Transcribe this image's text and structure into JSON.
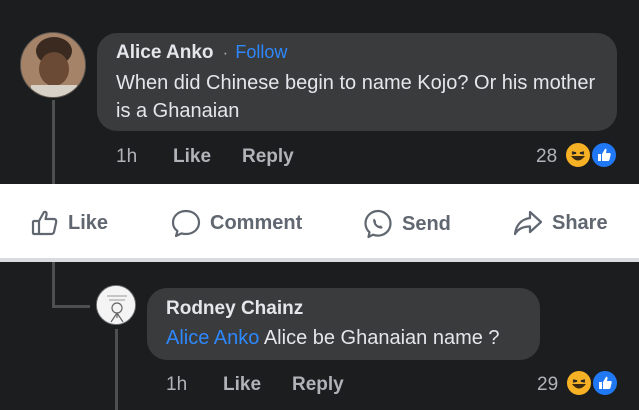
{
  "comment": {
    "author": "Alice Anko",
    "separator": "·",
    "follow_label": "Follow",
    "text": "When did Chinese begin to name Kojo? Or his mother is a Ghanaian",
    "time": "1h",
    "like_label": "Like",
    "reply_label": "Reply",
    "reaction_count": "28",
    "reactions": [
      "haha-icon",
      "like-icon"
    ]
  },
  "action_bar": {
    "like_label": "Like",
    "comment_label": "Comment",
    "send_label": "Send",
    "share_label": "Share"
  },
  "reply": {
    "author": "Rodney Chainz",
    "mention": "Alice Anko",
    "text": " Alice be Ghanaian name ?",
    "time": "1h",
    "like_label": "Like",
    "reply_label": "Reply",
    "reaction_count": "29",
    "reactions": [
      "haha-icon",
      "like-icon"
    ]
  },
  "colors": {
    "background": "#1c1d1f",
    "bubble": "#3a3b3c",
    "link": "#2d88ff",
    "haha": "#f7b125",
    "like": "#2078f4"
  }
}
